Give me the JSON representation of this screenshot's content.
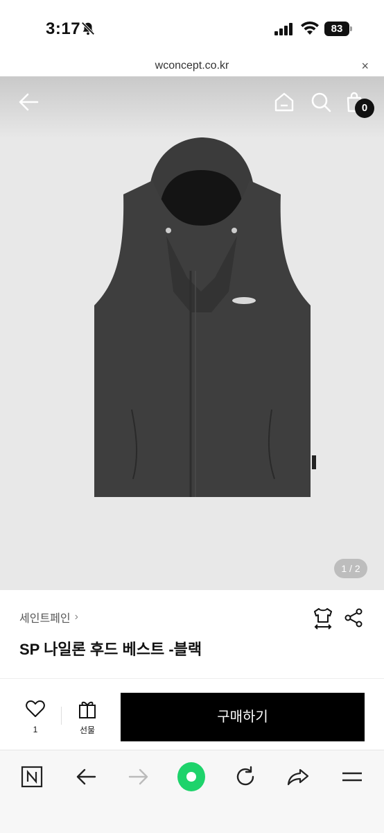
{
  "status_bar": {
    "time": "3:17",
    "battery": "83"
  },
  "browser": {
    "url": "wconcept.co.kr",
    "close_label": "×"
  },
  "header": {
    "cart_count": "0"
  },
  "gallery": {
    "pager": "1 / 2"
  },
  "product": {
    "brand": "세인트페인",
    "title": "SP 나일론 후드 베스트 -블랙"
  },
  "actions": {
    "like_count": "1",
    "gift_label": "선물",
    "buy_label": "구매하기"
  },
  "colors": {
    "accent_green": "#1ed36b",
    "buy_button": "#000000",
    "product": "#3a3a3a"
  },
  "icons": [
    "bell-slash-icon",
    "signal-icon",
    "wifi-icon",
    "back-arrow-icon",
    "home-icon",
    "search-icon",
    "cart-icon",
    "fit-icon",
    "share-icon",
    "heart-icon",
    "gift-icon",
    "naver-icon",
    "reload-icon",
    "menu-icon"
  ]
}
